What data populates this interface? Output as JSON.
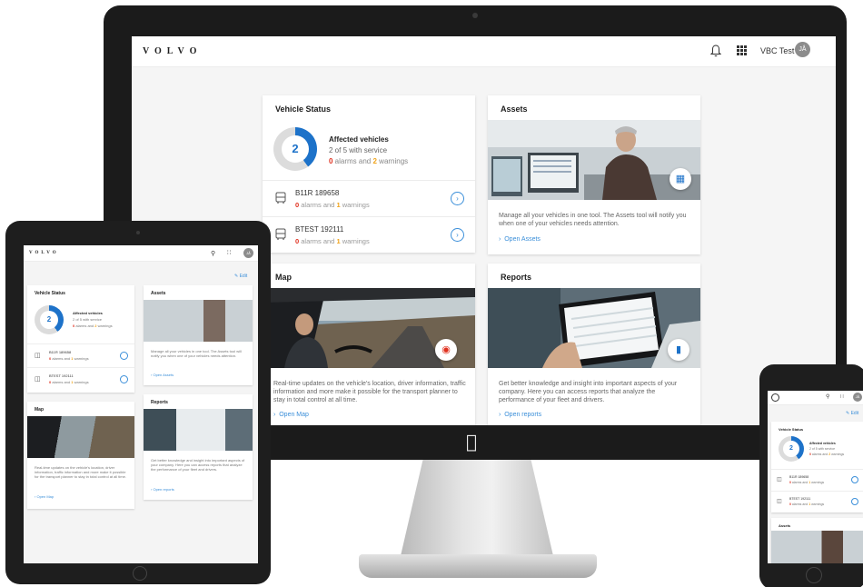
{
  "brand": {
    "logo": "VOLVO",
    "accent": "#1d72c9",
    "link": "#3b8fd9",
    "alarm": "#e0301e",
    "warning": "#f0a31a"
  },
  "header": {
    "user_name": "VBC Test",
    "avatar_initials": "JÅ",
    "icons": [
      "bell-icon",
      "apps-grid-icon"
    ]
  },
  "vehicle_status": {
    "title": "Vehicle Status",
    "donut_count": "2",
    "donut_fraction": 0.4,
    "affected_title": "Affected vehicles",
    "affected_sub": "2 of 5 with service",
    "alarms_num": "0",
    "alarms_word": " alarms and ",
    "warnings_num": "2",
    "warnings_word": " warnings",
    "vehicles": [
      {
        "plate": "B11R 189658",
        "alarms": "0",
        "mid": " alarms and ",
        "warnings": "1",
        "end": " warnings"
      },
      {
        "plate": "BTEST 192111",
        "alarms": "0",
        "mid": " alarms and ",
        "warnings": "1",
        "end": " warnings"
      }
    ]
  },
  "assets": {
    "title": "Assets",
    "description": "Manage all your vehicles in one tool. The Assets tool will notify you when one of your vehicles needs attention.",
    "link": "Open Assets"
  },
  "map": {
    "title": "Map",
    "description": "Real-time updates on the vehicle's location, driver information, traffic information and more make it possible for the transport planner to stay in total control at all time.",
    "link": "Open Map"
  },
  "reports": {
    "title": "Reports",
    "description": "Get better knowledge and insight into important aspects of your company. Here you can access reports that analyze the performance of your fleet and drivers.",
    "link": "Open reports"
  },
  "tablet": {
    "edit_label": "Edit"
  },
  "phone": {
    "edit_label": "Edit"
  }
}
